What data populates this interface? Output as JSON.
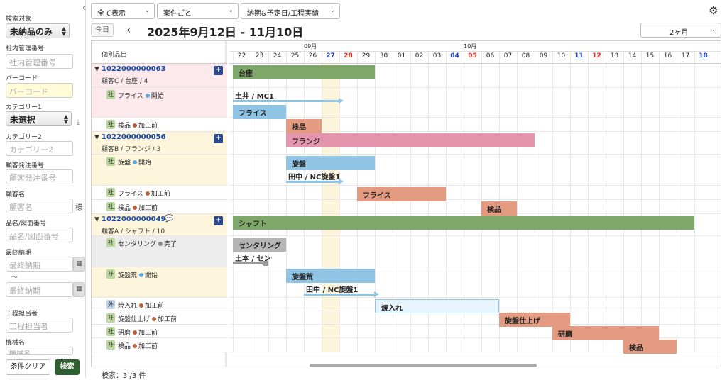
{
  "sidebar": {
    "search_target_label": "検索対象",
    "search_target_value": "未納品のみ",
    "internal_no_label": "社内管理番号",
    "internal_no_placeholder": "社内管理番号",
    "barcode_label": "バーコード",
    "barcode_placeholder": "バーコード",
    "category1_label": "カテゴリー1",
    "category1_value": "未選択",
    "category2_label": "カテゴリー2",
    "category2_placeholder": "カテゴリー2",
    "customer_order_label": "顧客発注番号",
    "customer_order_placeholder": "顧客発注番号",
    "customer_label": "顧客名",
    "customer_placeholder": "顧客名",
    "customer_suffix": "様",
    "drawing_label": "品名/図面番号",
    "drawing_placeholder": "品名/図面番号",
    "due_label": "最終納期",
    "due_from_placeholder": "最終納期",
    "due_sep": "〜",
    "due_to_placeholder": "最終納期",
    "worker_label": "工程担当者",
    "worker_placeholder": "工程担当者",
    "machine_label": "機械名",
    "machine_placeholder": "機械名",
    "clear_button": "条件クリア",
    "search_button": "検索"
  },
  "toolbar": {
    "show_all": "全て表示",
    "group_by": "案件ごと",
    "date_mode": "納期&予定日/工程実績"
  },
  "nav": {
    "today": "今日",
    "date_range": "2025年9月12日 - 11月10日",
    "period": "2ヶ月"
  },
  "grid": {
    "header_left": "個別品目",
    "months": [
      {
        "label": "09月",
        "start": 0
      },
      {
        "label": "10月",
        "start": 9
      }
    ],
    "days": [
      {
        "d": "22",
        "t": ""
      },
      {
        "d": "23",
        "t": ""
      },
      {
        "d": "24",
        "t": ""
      },
      {
        "d": "25",
        "t": ""
      },
      {
        "d": "26",
        "t": ""
      },
      {
        "d": "27",
        "t": "sat"
      },
      {
        "d": "28",
        "t": "sun"
      },
      {
        "d": "29",
        "t": ""
      },
      {
        "d": "30",
        "t": ""
      },
      {
        "d": "01",
        "t": ""
      },
      {
        "d": "02",
        "t": ""
      },
      {
        "d": "03",
        "t": ""
      },
      {
        "d": "04",
        "t": "sat"
      },
      {
        "d": "05",
        "t": "sun"
      },
      {
        "d": "06",
        "t": ""
      },
      {
        "d": "07",
        "t": ""
      },
      {
        "d": "08",
        "t": ""
      },
      {
        "d": "09",
        "t": ""
      },
      {
        "d": "10",
        "t": ""
      },
      {
        "d": "11",
        "t": "sat"
      },
      {
        "d": "12",
        "t": "sun"
      },
      {
        "d": "13",
        "t": ""
      },
      {
        "d": "14",
        "t": ""
      },
      {
        "d": "15",
        "t": ""
      },
      {
        "d": "16",
        "t": ""
      },
      {
        "d": "17",
        "t": ""
      },
      {
        "d": "18",
        "t": "sat"
      }
    ],
    "today_index": 5,
    "rows": [
      {
        "type": "project",
        "h": 34,
        "bg": "#fbe9ec",
        "id": "1022000000063",
        "sub": "顧客C / 台座 / 4",
        "chat": false
      },
      {
        "type": "process",
        "h": 42,
        "bg": "#fbe9ec",
        "kind": "社",
        "name": "フライス",
        "status": "開始",
        "sc": "#5aa9e0"
      },
      {
        "type": "process",
        "h": 20,
        "bg": "#ffffff",
        "kind": "社",
        "name": "検品",
        "status": "加工前",
        "sc": "#c0603a"
      },
      {
        "type": "project",
        "h": 32,
        "bg": "#fdf6dc",
        "id": "1022000000056",
        "sub": "顧客B / フランジ / 3",
        "chat": false
      },
      {
        "type": "process",
        "h": 44,
        "bg": "#fdf6dc",
        "kind": "社",
        "name": "旋盤",
        "status": "開始",
        "sc": "#5aa9e0"
      },
      {
        "type": "process",
        "h": 20,
        "bg": "#ffffff",
        "kind": "社",
        "name": "フライス",
        "status": "加工前",
        "sc": "#c0603a"
      },
      {
        "type": "process",
        "h": 20,
        "bg": "#ffffff",
        "kind": "社",
        "name": "検品",
        "status": "加工前",
        "sc": "#c0603a"
      },
      {
        "type": "project",
        "h": 31,
        "bg": "#fdf6dc",
        "id": "1022000000049",
        "sub": "顧客A / シャフト / 10",
        "chat": true
      },
      {
        "type": "process",
        "h": 44,
        "bg": "#ececec",
        "kind": "社",
        "name": "センタリング",
        "status": "完了",
        "sc": "#888888"
      },
      {
        "type": "process",
        "h": 43,
        "bg": "#fdf6dc",
        "kind": "社",
        "name": "旋盤荒",
        "status": "開始",
        "sc": "#5aa9e0"
      },
      {
        "type": "process",
        "h": 19,
        "bg": "#ffffff",
        "kind": "外",
        "name": "焼入れ",
        "status": "加工前",
        "sc": "#c0603a"
      },
      {
        "type": "process",
        "h": 19,
        "bg": "#ffffff",
        "kind": "社",
        "name": "旋盤仕上げ",
        "status": "加工前",
        "sc": "#c0603a"
      },
      {
        "type": "process",
        "h": 19,
        "bg": "#ffffff",
        "kind": "社",
        "name": "研磨",
        "status": "加工前",
        "sc": "#c0603a"
      },
      {
        "type": "process",
        "h": 20,
        "bg": "#ffffff",
        "kind": "社",
        "name": "検品",
        "status": "加工前",
        "sc": "#c0603a"
      }
    ],
    "bars": [
      {
        "row": 0,
        "s": 0,
        "e": 8,
        "label": "台座",
        "color": "#7fa86a",
        "off": 0
      },
      {
        "row": 1,
        "s": 0,
        "e": 3,
        "label": "フライス",
        "color": "#8fc4e4",
        "off": 22
      },
      {
        "row": 2,
        "s": 3,
        "e": 5,
        "label": "検品",
        "color": "#e49a80",
        "off": 0
      },
      {
        "row": 3,
        "s": 3,
        "e": 17,
        "label": "フランジ",
        "color": "#e595ae",
        "off": 0
      },
      {
        "row": 4,
        "s": 3,
        "e": 8,
        "label": "旋盤",
        "color": "#8fc4e4",
        "off": 0
      },
      {
        "row": 5,
        "s": 7,
        "e": 12,
        "label": "フライス",
        "color": "#e49a80",
        "off": 0
      },
      {
        "row": 6,
        "s": 14,
        "e": 16,
        "label": "検品",
        "color": "#e49a80",
        "off": 0
      },
      {
        "row": 7,
        "s": 0,
        "e": 26,
        "label": "シャフト",
        "color": "#7fa86a",
        "off": 0
      },
      {
        "row": 8,
        "s": 0,
        "e": 3,
        "label": "センタリング",
        "color": "#b5b5b5",
        "off": 0
      },
      {
        "row": 9,
        "s": 3,
        "e": 8,
        "label": "旋盤荒",
        "color": "#8fc4e4",
        "off": 0
      },
      {
        "row": 10,
        "s": 8,
        "e": 15,
        "label": "焼入れ",
        "color": "#e8f4fb",
        "off": 0
      },
      {
        "row": 11,
        "s": 15,
        "e": 19,
        "label": "旋盤仕上げ",
        "color": "#e49a80",
        "off": 0
      },
      {
        "row": 12,
        "s": 18,
        "e": 24,
        "label": "研磨",
        "color": "#e49a80",
        "off": 0
      },
      {
        "row": 13,
        "s": 22,
        "e": 25,
        "label": "検品",
        "color": "#e49a80",
        "off": 0
      }
    ],
    "actuals": [
      {
        "row": 1,
        "s": 0,
        "e": 6,
        "label": "土井 / MC1",
        "color": "#8fc4e4",
        "arrow": true
      },
      {
        "row": 4,
        "s": 3,
        "e": 6,
        "label": "田中 / NC旋盤1",
        "color": "#8fc4e4",
        "arrow": true
      },
      {
        "row": 8,
        "s": 0,
        "e": 2,
        "label": "土本 / センタリング",
        "color": "#999999",
        "arrow": false
      },
      {
        "row": 9,
        "s": 4,
        "e": 8,
        "label": "田中 / NC旋盤1",
        "color": "#8fc4e4",
        "arrow": true
      }
    ]
  },
  "status": {
    "count": "検索：3 /3 件"
  }
}
